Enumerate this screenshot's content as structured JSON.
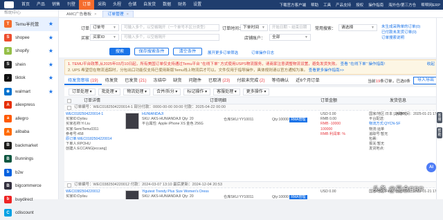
{
  "topnav": {
    "items": [
      "首页",
      "产品",
      "销售",
      "刊登",
      "订单",
      "采购",
      "头程",
      "仓储",
      "自发货",
      "数据",
      "财务",
      "设置"
    ],
    "active_index": 4,
    "right": [
      "下载官方客户端",
      "帮助",
      "工具",
      "产品支持",
      "授权",
      "操作指南",
      "海外仓/第三方仓",
      "帮帮网ERP"
    ]
  },
  "sidebar": {
    "header": "帮助中心",
    "items": [
      {
        "label": "Temu半托管",
        "color": "#f56c2d",
        "glyph": "T",
        "active": true,
        "star": true
      },
      {
        "label": "shopee",
        "color": "#ee4d2d",
        "glyph": "S",
        "star": true
      },
      {
        "label": "shopify",
        "color": "#95bf47",
        "glyph": "S",
        "star": true
      },
      {
        "label": "shein",
        "color": "#222222",
        "glyph": "S",
        "star": true
      },
      {
        "label": "tiktok",
        "color": "#111111",
        "glyph": "♪",
        "star": true
      },
      {
        "label": "walmart",
        "color": "#0071ce",
        "glyph": "✱",
        "star": true
      },
      {
        "label": "aliexpress",
        "color": "#e62e04",
        "glyph": "A",
        "star": false
      },
      {
        "label": "allegro",
        "color": "#ff5a00",
        "glyph": "a",
        "star": false
      },
      {
        "label": "alibaba",
        "color": "#ff6a00",
        "glyph": "A",
        "star": false
      },
      {
        "label": "backmarket",
        "color": "#1d1d1b",
        "glyph": "B",
        "star": false
      },
      {
        "label": "Bunnings",
        "color": "#0d5640",
        "glyph": "B",
        "star": false
      },
      {
        "label": "b2w",
        "color": "#0060df",
        "glyph": "b",
        "star": false
      },
      {
        "label": "bigcommerce",
        "color": "#34313f",
        "glyph": "B",
        "star": false
      },
      {
        "label": "buydirect",
        "color": "#ee2424",
        "glyph": "b",
        "star": false
      },
      {
        "label": "cdiscount",
        "color": "#00a1e4",
        "glyph": "C",
        "star": false
      }
    ]
  },
  "tabs": [
    {
      "label": "AMC广告看板",
      "active": false
    },
    {
      "label": "订单管理",
      "active": true
    }
  ],
  "filters": {
    "order_label": "订单：",
    "order_select": "订单号",
    "order_placeholder": "可输入多个，以空格隔开（一个单号不区分类型）",
    "buyer_label": "买家：",
    "buyer_select": "买家ID",
    "buyer_placeholder": "可输入多个，以空格隔开",
    "date_label": "订单时间：",
    "date_select": "下单时间",
    "date_start": "开始日期",
    "date_end": "结束日期",
    "store_label": "店铺账户：",
    "store_value": "全部",
    "search_condition_label": "常用搜索：",
    "search_condition_value": "请选择",
    "search_btn": "搜索",
    "save_btn": "保存搜索条件",
    "clear_btn": "清空条件",
    "more_filter": "展开更多订单筛选",
    "order_ops": "订单操作日志",
    "right_links": [
      "未生成采购单的订单(0)",
      "已付款未发货订单(0)",
      "订单搜索说明"
    ]
  },
  "notice": {
    "line1_pre": "1. TEMU平台政策,从2025年03月10日起，所有美国订单仅支持通过Temu平台 \"在线下单\" 方式使用USPS物流服务，请商家注意调整物流设置，避免发货失败。",
    "line1_link": "查看 \"在线下单\" 操作指南!",
    "line2": "2. UPS 希望您在物流追踪时，分包出口功能仅支持已使用新版Temu线上物流后才可以。文件仅用于指导操作，具体规则请以官方通知为准。",
    "line2_link": "查看更多操作指南>>",
    "toggle": "收起"
  },
  "status_tabs": [
    {
      "label": "待发货审核",
      "count": "19",
      "active": true
    },
    {
      "label": "待发货",
      "count": ""
    },
    {
      "label": "已发货",
      "count": "21"
    },
    {
      "label": "冻结中",
      "count": ""
    },
    {
      "label": "缺货",
      "count": ""
    },
    {
      "label": "问题件",
      "count": ""
    },
    {
      "label": "已取消",
      "count": "23"
    },
    {
      "label": "付款未完成",
      "count": "2"
    },
    {
      "label": "等待确认",
      "count": ""
    },
    {
      "label": "近6个月订单",
      "count": ""
    }
  ],
  "status_right": {
    "text": "当前",
    "count": "19",
    "suffix": "条订单，已选0条",
    "export": "导入导出"
  },
  "actions": [
    "订单处理",
    "批处理",
    "物流处理",
    "合并/拆分",
    "标记操作",
    "客服处理",
    "更多操作"
  ],
  "table": {
    "headers": [
      "订单详情",
      "订单明细",
      "订单金额",
      "发货信息"
    ],
    "rows": [
      {
        "head": "订单编号：WEC0182504220014-1  部分付款：0000-00-00 00:00  付款：2025-04-22 00:00",
        "buyer": [
          "WEC0182504220014-1",
          "买家ID:Dyilsu",
          "买家名称:Yi Liu",
          "买家:SemiTemu0311",
          "参考号:458",
          "原订单:WEC0182504220014",
          "下单人:RPOHU",
          "创建人:ECCANG[eccang]"
        ],
        "sku": "SKU: AKS-HUNIANDAJI",
        "title": "HUNIANDAJI",
        "qty": "Qty: 20",
        "warehouse": "仓库SKU:YY10011",
        "store": "平台属性: Apple iPhone XS 金色 256G",
        "amount": "Qty:10000",
        "price_tag": "RMA管理",
        "money": [
          "USD 0.00",
          "RMB 0.00",
          "RMB -10000",
          "100000",
          "RMB 利润率: %"
        ],
        "shipping": [
          "国家/地区:日本 [JAPAN]",
          "平台配送:",
          "物流方式:QYCN-SF",
          "物流:运单",
          "追踪号:暂无",
          "包裹:",
          "报关:暂无",
          "发货地点:"
        ],
        "date": "创建时间：2025-01-21 17:33"
      },
      {
        "head": "订单编号：WEC0382504220012  付款：2024-03-07 13:10  最后更新：2024-12-04 20:53",
        "buyer": [
          "WEC0382504220012",
          "买家ID:Dyilsu"
        ],
        "sku": "SKU: AKS-HUNIANDAJI",
        "title": "Yigutest Trendy Plus Size Women's Dress",
        "qty": "Qty: 20",
        "warehouse": "仓库SKU:YY10011",
        "store": "",
        "amount": "Qty:10000",
        "price_tag": "RMA管理",
        "money": [
          "USD 0.00"
        ],
        "shipping": [
          "国家/地区:First"
        ],
        "date": "创建时间：2025-01-21 17:33"
      }
    ]
  },
  "watermark": "头条 @易仓ERP",
  "ai_label": "AI",
  "rightbar": [
    "客服",
    "帮助"
  ]
}
